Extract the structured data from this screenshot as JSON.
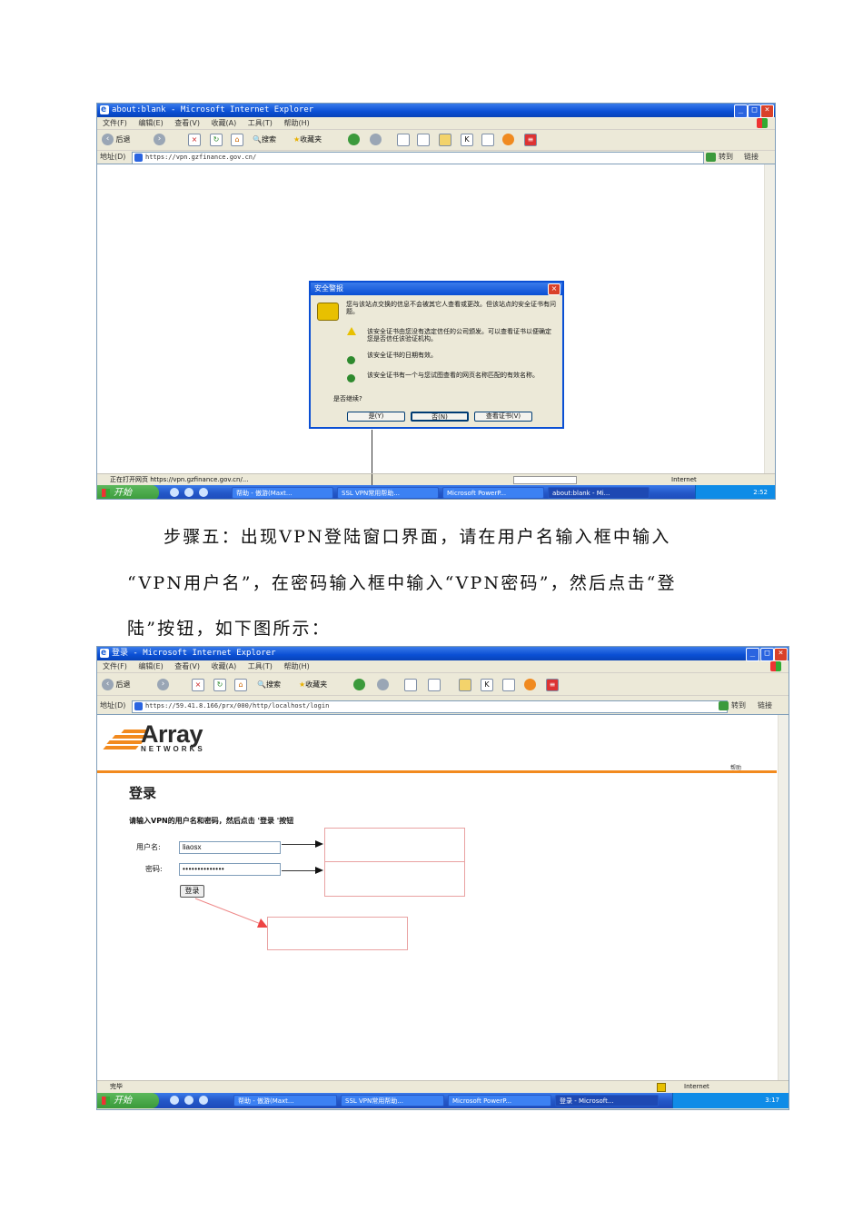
{
  "screenshot1": {
    "window_title": "about:blank - Microsoft Internet Explorer",
    "menu": [
      "文件(F)",
      "编辑(E)",
      "查看(V)",
      "收藏(A)",
      "工具(T)",
      "帮助(H)"
    ],
    "toolbar": {
      "back": "后退",
      "search": "搜索",
      "favorites": "收藏夹"
    },
    "address_label": "地址(D)",
    "address": "https://vpn.gzfinance.gov.cn/",
    "go_label": "转到",
    "links_label": "链接",
    "status_text": "正在打开网页 https://vpn.gzfinance.gov.cn/...",
    "status_zone": "Internet",
    "taskbar": {
      "start": "开始",
      "tasks": [
        "帮助 - 傲游(Maxt...",
        "SSL VPN常用帮助...",
        "Microsoft PowerP...",
        "about:blank - Mi..."
      ],
      "clock": "2:52"
    },
    "dialog": {
      "title": "安全警报",
      "intro": "您与该站点交换的信息不会被其它人查看或更改。但该站点的安全证书有问题。",
      "items": [
        {
          "icon": "warning-icon",
          "text": "该安全证书由您没有选定信任的公司颁发。可以查看证书以便确定您是否信任该验证机构。"
        },
        {
          "icon": "check-icon",
          "text": "该安全证书的日期有效。"
        },
        {
          "icon": "check-icon",
          "text": "该安全证书有一个与您试图查看的网页名称匹配的有效名称。"
        }
      ],
      "question": "是否继续?",
      "buttons": {
        "yes": "是(Y)",
        "no": "否(N)",
        "view": "查看证书(V)"
      }
    }
  },
  "step_text": {
    "line1": "步骤五：出现VPN登陆窗口界面，请在用户名输入框中输入",
    "line2": "“VPN用户名”，在密码输入框中输入“VPN密码”，然后点击“登",
    "line3": "陆”按钮，如下图所示："
  },
  "screenshot2": {
    "window_title": "登录 - Microsoft Internet Explorer",
    "menu": [
      "文件(F)",
      "编辑(E)",
      "查看(V)",
      "收藏(A)",
      "工具(T)",
      "帮助(H)"
    ],
    "toolbar": {
      "back": "后退",
      "search": "搜索",
      "favorites": "收藏夹"
    },
    "address_label": "地址(D)",
    "address": "https://59.41.8.166/prx/000/http/localhost/login",
    "go_label": "转到",
    "links_label": "链接",
    "logo": {
      "name": "Array",
      "sub": "NETWORKS"
    },
    "help_link": "帮助",
    "login_title": "登录",
    "instruction": "请输入VPN的用户名和密码，然后点击 '登录 '按钮",
    "username_label": "用户名:",
    "username_value": "liaosx",
    "password_label": "密码:",
    "password_value": "••••••••••••••",
    "login_button": "登录",
    "status_text": "完毕",
    "status_zone": "Internet",
    "taskbar": {
      "start": "开始",
      "tasks": [
        "帮助 - 傲游(Maxt...",
        "SSL VPN常用帮助...",
        "Microsoft PowerP...",
        "登录 - Microsoft..."
      ],
      "clock": "3:17"
    }
  }
}
